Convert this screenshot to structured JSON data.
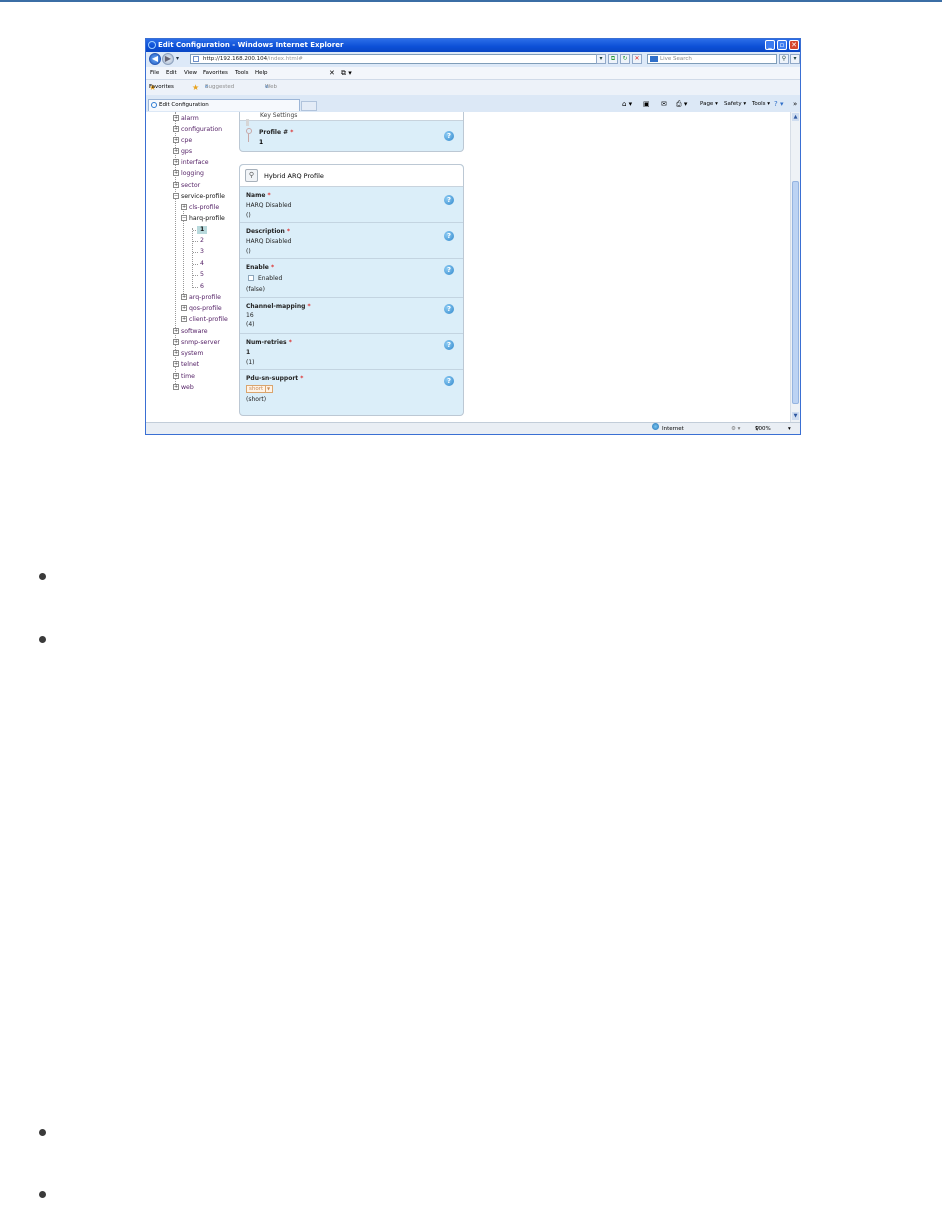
{
  "window": {
    "title": "Edit Configuration - Windows Internet Explorer",
    "url_host": "http://192.168.200.104",
    "url_path": "/index.html#",
    "search_placeholder": "Live Search"
  },
  "menu": [
    "File",
    "Edit",
    "View",
    "Favorites",
    "Tools",
    "Help"
  ],
  "favorites": {
    "label": "Favorites",
    "items": [
      "Suggested Sites ▾",
      "Web Slice Gallery ▾"
    ]
  },
  "tab": {
    "label": "Edit Configuration"
  },
  "command_bar": [
    "Page ▾",
    "Safety ▾",
    "Tools ▾"
  ],
  "tree": {
    "items": [
      "alarm",
      "configuration",
      "cpe",
      "gps",
      "interface",
      "logging",
      "sector",
      "service-profile"
    ],
    "service_profile_children": [
      "cls-profile",
      "harq-profile"
    ],
    "harq_children": [
      "1",
      "2",
      "3",
      "4",
      "5",
      "6"
    ],
    "service_profile_tail": [
      "arq-profile",
      "qos-profile",
      "client-profile"
    ],
    "tail": [
      "software",
      "snmp-server",
      "system",
      "telnet",
      "time",
      "web"
    ]
  },
  "top_panel": {
    "partial_title": "Key Settings",
    "profile_label": "Profile #",
    "profile_value": "1"
  },
  "hybrid_panel": {
    "title": "Hybrid ARQ Profile",
    "fields": {
      "name": {
        "label": "Name",
        "value": "HARQ Disabled",
        "default": "()"
      },
      "description": {
        "label": "Description",
        "value": "HARQ Disabled",
        "default": "()"
      },
      "enable": {
        "label": "Enable",
        "checkbox_label": "Enabled",
        "default": "(false)",
        "checked": false
      },
      "channel_mapping": {
        "label": "Channel-mapping",
        "value": "16",
        "default": "(4)"
      },
      "num_retries": {
        "label": "Num-retries",
        "value": "1",
        "default": "(1)"
      },
      "pdu_sn_support": {
        "label": "Pdu-sn-support",
        "value": "short",
        "default": "(short)"
      }
    }
  },
  "status": {
    "zone": "Internet",
    "zoom": "100%"
  },
  "colors": {
    "title_bar": "#0c4fd6",
    "panel_bg": "#dbeef9",
    "tree_link": "#552267",
    "help_icon": "#2f86cb"
  }
}
